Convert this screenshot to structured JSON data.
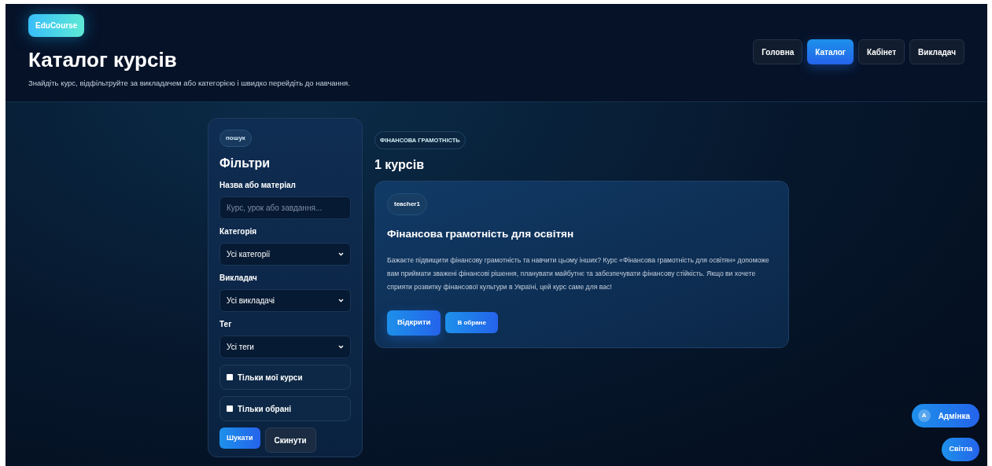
{
  "brand": "EduCourse",
  "title": "Каталог курсів",
  "subtitle": "Знайдіть курс, відфільтруйте за викладачем або категорією і швидко перейдіть до навчання.",
  "nav": [
    {
      "label": "Головна",
      "selected": false
    },
    {
      "label": "Каталог",
      "selected": true
    },
    {
      "label": "Кабінет",
      "selected": false
    },
    {
      "label": "Викладач",
      "selected": false
    }
  ],
  "filters": {
    "badge": "пошук",
    "heading": "Фільтри",
    "fields": [
      {
        "kind": "input",
        "label": "Назва або матеріал",
        "placeholder": "Курс, урок або завдання..."
      },
      {
        "kind": "select",
        "label": "Категорія",
        "value": "Усі категорії"
      },
      {
        "kind": "select",
        "label": "Викладач",
        "value": "Усі викладачі"
      },
      {
        "kind": "select",
        "label": "Тег",
        "value": "Усі теги"
      }
    ],
    "checkboxes": [
      {
        "label": "Тільки мої курси",
        "checked": false
      },
      {
        "label": "Тільки обрані",
        "checked": false
      }
    ],
    "search_button": "Шукати",
    "reset_button": "Скинути"
  },
  "category_tag": "ФІНАНСОВА ГРАМОТНІСТЬ",
  "count": "1 курсів",
  "courses": [
    {
      "teacher": "teacher1",
      "title": "Фінансова грамотність для освітян",
      "description": "Бажаєте підвищити фінансову грамотність та навчити цьому інших? Курс «Фінансова грамотність для освітян» допоможе вам приймати зважені фінансові рішення, планувати майбутнє та забезпечувати фінансову стійкість. Якщо ви хочете сприяти розвитку фінансової культури в Україні, цей курс саме для вас!",
      "open_button": "Відкрити",
      "favorite_button": "В обране"
    }
  ],
  "admin": {
    "initial": "A",
    "label": "Адмінка"
  },
  "theme_button": "Світла"
}
